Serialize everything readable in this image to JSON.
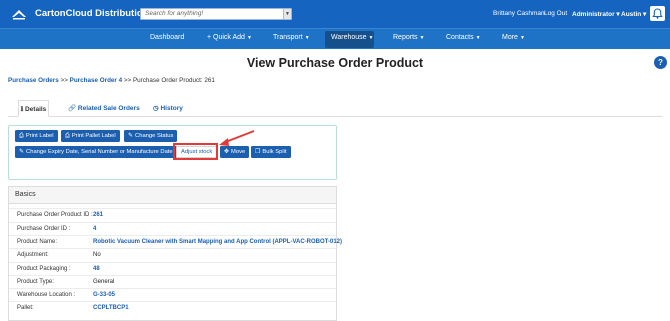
{
  "topbar": {
    "brand": "CartonCloud Distribution",
    "search_placeholder": "Search for anything!",
    "user_name": "Brittany Cashman",
    "logout": "Log Out",
    "role": "Administrator",
    "location": "Austin"
  },
  "nav": {
    "items": [
      {
        "label": "Dashboard"
      },
      {
        "label": "+ Quick Add"
      },
      {
        "label": "Transport"
      },
      {
        "label": "Warehouse"
      },
      {
        "label": "Reports"
      },
      {
        "label": "Contacts"
      },
      {
        "label": "More"
      }
    ],
    "active": "Warehouse"
  },
  "page": {
    "title": "View Purchase Order Product",
    "help": "?"
  },
  "breadcrumb": {
    "link1": "Purchase Orders",
    "sep1": ">>",
    "link2": "Purchase Order 4",
    "sep2": ">>",
    "current": "Purchase Order Product: 261"
  },
  "tabs": [
    {
      "label": "Details",
      "icon": "info-icon"
    },
    {
      "label": "Related Sale Orders",
      "icon": "link-icon"
    },
    {
      "label": "History",
      "icon": "clock-icon"
    }
  ],
  "actions": {
    "print_label": "Print Label",
    "print_pallet_label": "Print Pallet Label",
    "change_status": "Change Status",
    "change_expiry": "Change Expiry Date, Serial Number or Manufacture Date",
    "adjust_stock": "Adjust stock",
    "move": "Move",
    "bulk_split": "Bulk Split"
  },
  "basics": {
    "title": "Basics",
    "rows": [
      {
        "label": "Purchase Order Product ID :",
        "value": "261"
      },
      {
        "label": "Purchase Order ID :",
        "value": "4"
      },
      {
        "label": "Product Name:",
        "value": "Robotic Vacuum Cleaner with Smart Mapping and App Control (APPL-VAC-ROBOT-012)"
      },
      {
        "label": "Adjustment:",
        "value": "No"
      },
      {
        "label": "Product Packaging :",
        "value": "48"
      },
      {
        "label": "Product Type:",
        "value": "General"
      },
      {
        "label": "Warehouse Location :",
        "value": "G-33-05"
      },
      {
        "label": "Pallet:",
        "value": "CCPLTBCP1"
      }
    ]
  },
  "colors": {
    "topbar": "#1565c0",
    "navbar": "#1f73c7",
    "button": "#1c5fae",
    "highlight": "#e03a3a"
  }
}
